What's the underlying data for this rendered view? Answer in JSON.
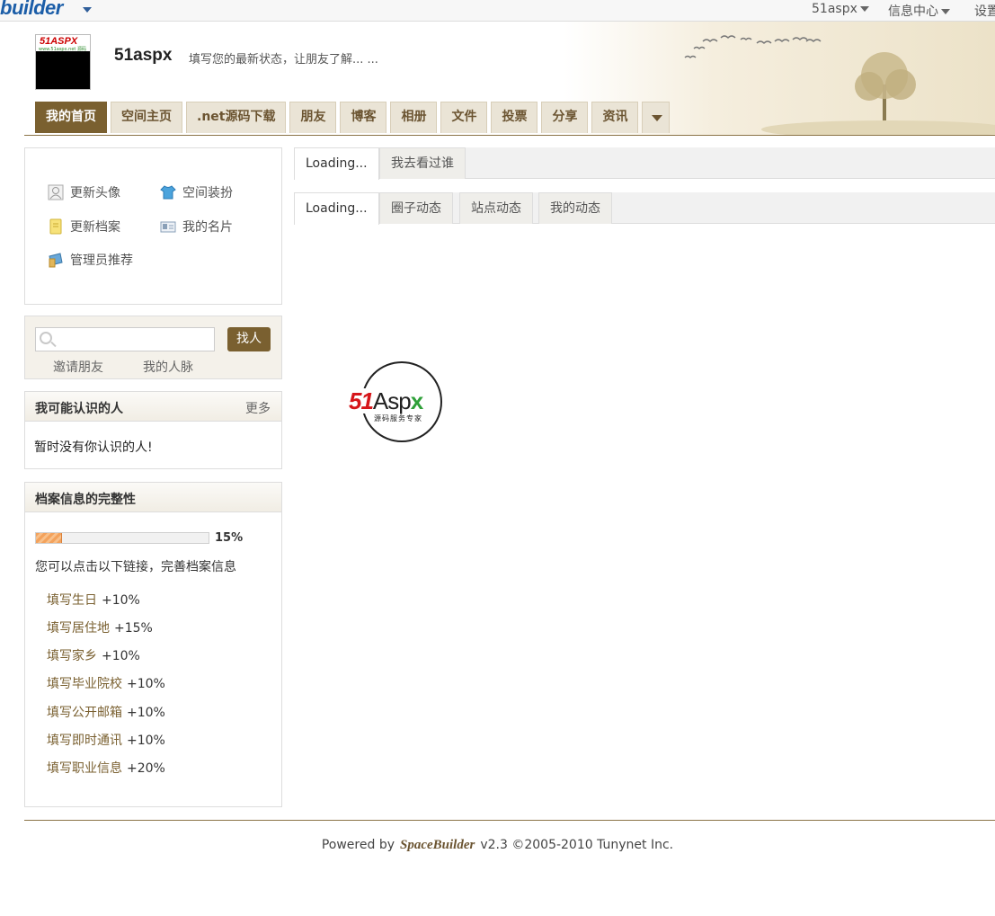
{
  "topbar": {
    "brand": "builder",
    "menu": [
      {
        "label": "51aspx"
      },
      {
        "label": "信息中心"
      },
      {
        "label": "设置"
      }
    ]
  },
  "header": {
    "avatar_logo": "51ASPX",
    "avatar_sub": "www.51aspx.net 源码",
    "username": "51aspx",
    "status_placeholder": "填写您的最新状态，让朋友了解... ..."
  },
  "nav": {
    "tabs": [
      "我的首页",
      "空间主页",
      ".net源码下载",
      "朋友",
      "博客",
      "相册",
      "文件",
      "投票",
      "分享",
      "资讯"
    ]
  },
  "actions": [
    "更新头像",
    "空间装扮",
    "更新档案",
    "我的名片",
    "管理员推荐"
  ],
  "search": {
    "value": "",
    "button": "找人",
    "links": [
      "邀请朋友",
      "我的人脉"
    ]
  },
  "people": {
    "title": "我可能认识的人",
    "more": "更多",
    "empty": "暂时没有你认识的人!"
  },
  "profile": {
    "title": "档案信息的完整性",
    "progress": 0.15,
    "progress_label": "15%",
    "hint": "您可以点击以下链接，完善档案信息",
    "tasks": [
      {
        "label": "填写生日",
        "bonus": "+10%"
      },
      {
        "label": "填写居住地",
        "bonus": "+15%"
      },
      {
        "label": "填写家乡",
        "bonus": "+10%"
      },
      {
        "label": "填写毕业院校",
        "bonus": "+10%"
      },
      {
        "label": "填写公开邮箱",
        "bonus": "+10%"
      },
      {
        "label": "填写即时通讯",
        "bonus": "+10%"
      },
      {
        "label": "填写职业信息",
        "bonus": "+20%"
      }
    ]
  },
  "main": {
    "tabs1": [
      "Loading...",
      "我去看过谁"
    ],
    "tabs2": [
      "Loading...",
      "圈子动态",
      "站点动态",
      "我的动态"
    ]
  },
  "loader": {
    "logo_a": "51",
    "logo_b": "Asp",
    "logo_c": "x",
    "sub": "源码服务专家"
  },
  "footer": {
    "prefix": "Powered by",
    "brand": "SpaceBuilder",
    "suffix": "v2.3 ©2005-2010 Tunynet Inc."
  }
}
